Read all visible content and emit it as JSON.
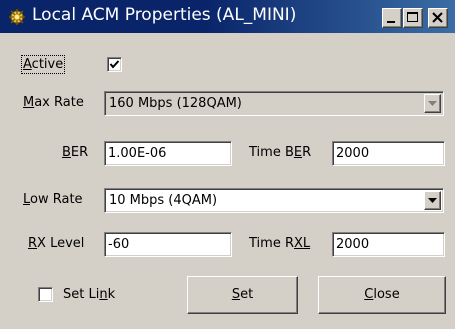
{
  "window": {
    "title": "Local ACM Properties (AL_MINI)",
    "app_icon": "satellite-dish-icon",
    "controls": {
      "minimize": "minimize-icon",
      "maximize": "maximize-icon",
      "close": "close-icon"
    }
  },
  "active": {
    "label_pre": "",
    "label_key": "A",
    "label_post": "ctive",
    "checked": true
  },
  "max_rate": {
    "label_pre": "",
    "label_key": "M",
    "label_post": "ax Rate",
    "value": "160 Mbps (128QAM)",
    "enabled": false
  },
  "ber": {
    "label_key": "B",
    "label_post": "ER",
    "value": "1.00E-06"
  },
  "time_ber": {
    "label_pre": "Time B",
    "label_key": "E",
    "label_post": "R",
    "value": "2000"
  },
  "low_rate": {
    "label_pre": "",
    "label_key": "L",
    "label_post": "ow Rate",
    "value": "10 Mbps (4QAM)",
    "enabled": true
  },
  "rx_level": {
    "label_key": "R",
    "label_post": "X Level",
    "value": "-60"
  },
  "time_rxl": {
    "label_pre": "Time R",
    "label_key": "X",
    "label_mid": "L",
    "value": "2000"
  },
  "set_link": {
    "label_pre": "Set Li",
    "label_key": "n",
    "label_post": "k",
    "checked": false
  },
  "buttons": {
    "set": {
      "label_key": "S",
      "label_post": "et"
    },
    "close": {
      "label_key": "C",
      "label_post": "lose"
    }
  },
  "colors": {
    "titlebar": "#0a246a",
    "face": "#d4d0c8",
    "disabled_text": "#808080"
  }
}
